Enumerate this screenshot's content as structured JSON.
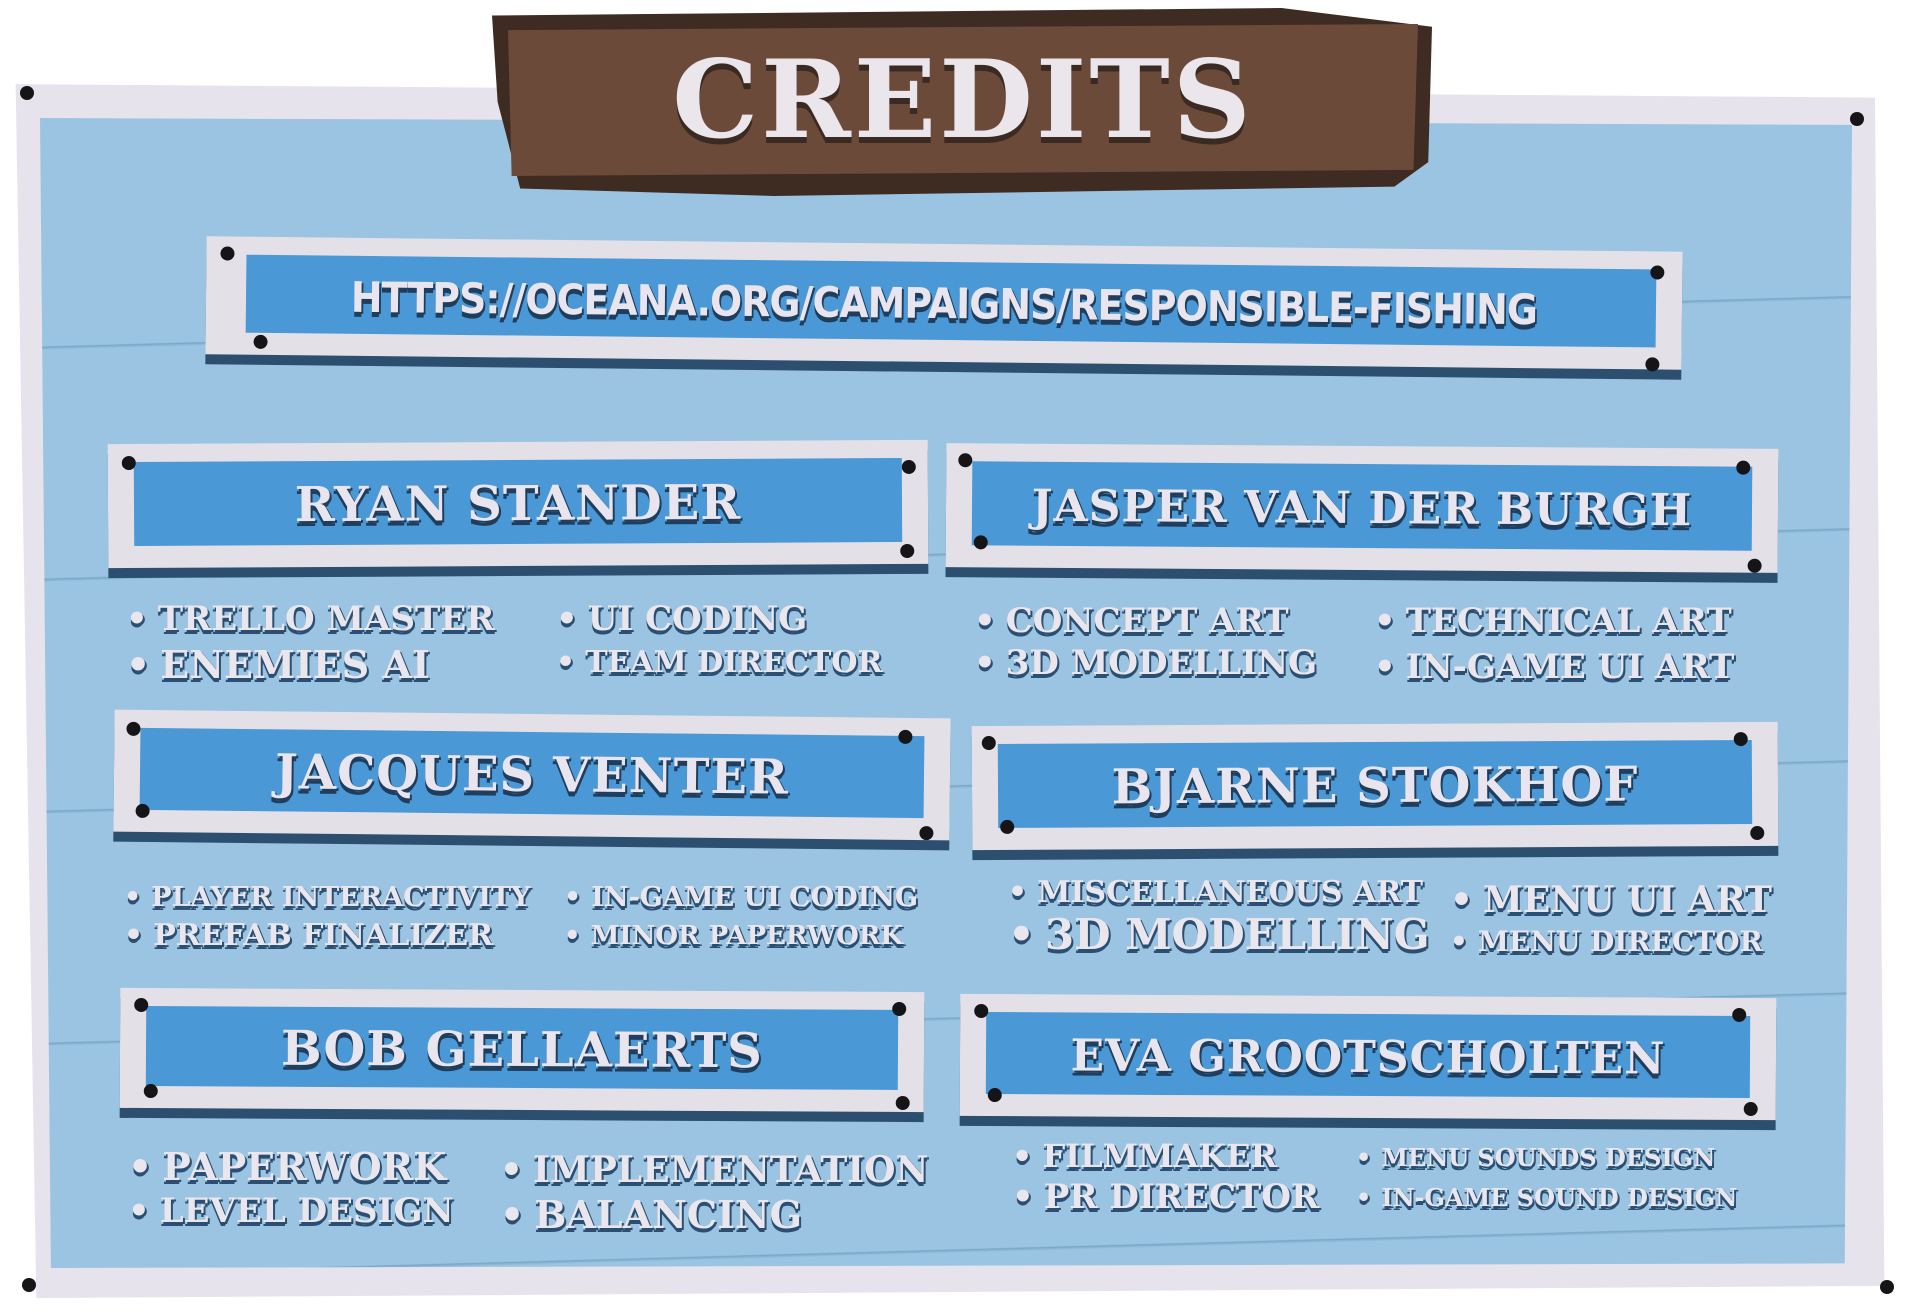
{
  "title": "CREDITS",
  "link": "HTTPS://OCEANA.ORG/CAMPAIGNS/RESPONSIBLE-FISHING",
  "bullet": "•",
  "credits": [
    {
      "name": "RYAN STANDER",
      "roles_left": [
        "TRELLO MASTER",
        "ENEMIES AI"
      ],
      "roles_right": [
        "UI CODING",
        "TEAM DIRECTOR"
      ]
    },
    {
      "name": "JASPER VAN DER BURGH",
      "roles_left": [
        "CONCEPT ART",
        "3D MODELLING"
      ],
      "roles_right": [
        "TECHNICAL ART",
        "IN-GAME UI ART"
      ]
    },
    {
      "name": "JACQUES VENTER",
      "roles_left": [
        "PLAYER INTERACTIVITY",
        "PREFAB FINALIZER"
      ],
      "roles_right": [
        "IN-GAME UI CODING",
        "MINOR PAPERWORK"
      ]
    },
    {
      "name": "BJARNE STOKHOF",
      "roles_left": [
        "MISCELLANEOUS ART",
        "3D MODELLING"
      ],
      "roles_right": [
        "MENU UI ART",
        "MENU DIRECTOR"
      ]
    },
    {
      "name": "BOB GELLAERTS",
      "roles_left": [
        "PAPERWORK",
        "LEVEL DESIGN"
      ],
      "roles_right": [
        "IMPLEMENTATION",
        "BALANCING"
      ]
    },
    {
      "name": "EVA GROOTSCHOLTEN",
      "roles_left": [
        "FILMMAKER",
        "PR DIRECTOR"
      ],
      "roles_right": [
        "MENU SOUNDS DESIGN",
        "IN-GAME SOUND DESIGN"
      ]
    }
  ]
}
